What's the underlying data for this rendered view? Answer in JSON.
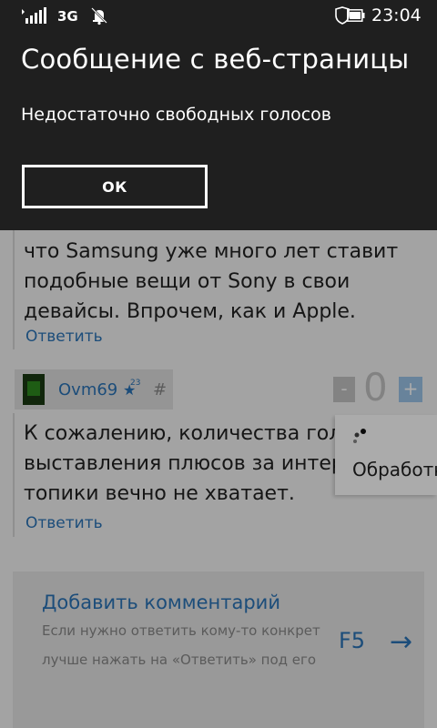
{
  "status_bar": {
    "network_type": "3G",
    "time": "23:04",
    "icons": [
      "signal-icon",
      "quiet-hours-icon",
      "shield-icon",
      "battery-icon"
    ]
  },
  "dialog": {
    "title": "Сообщение с веб-страницы",
    "message": "Недостаточно свободных голосов",
    "ok_label": "ОК"
  },
  "comments": [
    {
      "text_lines": [
        "что Samsung уже много лет ставит",
        "подобные вещи от Sony в свои",
        "девайсы. Впрочем, как и Apple."
      ],
      "reply_label": "Ответить"
    },
    {
      "author": "Ovm69",
      "author_star": "★",
      "author_rank": "23",
      "permalink": "#",
      "score": "0",
      "vote_minus": "-",
      "vote_plus": "+",
      "text_lines": [
        "К сожалению, количества голос",
        "выставления плюсов за интере",
        "топики вечно не хватает."
      ],
      "reply_label": "Ответить"
    }
  ],
  "processing_popup": {
    "label": "Обработк"
  },
  "add_comment": {
    "title": "Добавить комментарий",
    "hint_line1": "Если нужно ответить кому-то конкрет",
    "hint_line2": "лучше нажать на «Ответить» под его"
  },
  "refresh": {
    "label": "F5",
    "arrow": "→"
  },
  "colors": {
    "dialog_bg": "#1f1f1f",
    "link_blue": "#2b73b7",
    "page_bg": "#f4f4f4"
  }
}
